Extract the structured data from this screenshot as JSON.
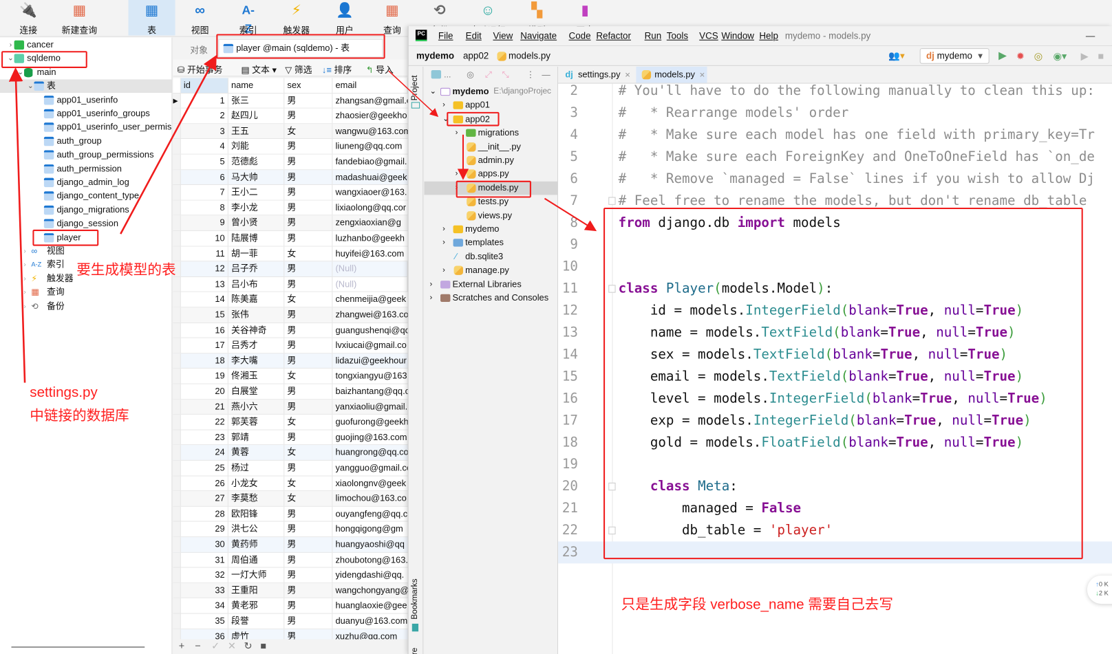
{
  "navicat": {
    "toolbar": [
      {
        "label": "连接",
        "icon": "plug-icon"
      },
      {
        "label": "新建查询",
        "icon": "new-query-icon"
      },
      {
        "label": "表",
        "icon": "table-icon",
        "selected": true
      },
      {
        "label": "视图",
        "icon": "view-icon"
      },
      {
        "label": "索引",
        "icon": "index-icon"
      },
      {
        "label": "触发器",
        "icon": "trigger-icon"
      },
      {
        "label": "用户",
        "icon": "user-icon"
      },
      {
        "label": "查询",
        "icon": "query-icon"
      },
      {
        "label": "备份",
        "icon": "backup-icon"
      },
      {
        "label": "自动运行",
        "icon": "robot-icon"
      },
      {
        "label": "模型",
        "icon": "model-icon"
      },
      {
        "label": "图表",
        "icon": "chart-icon"
      }
    ],
    "tree": {
      "connections": [
        "cancer",
        "sqldemo"
      ],
      "schema": "main",
      "tables_label": "表",
      "tables": [
        "app01_userinfo",
        "app01_userinfo_groups",
        "app01_userinfo_user_permiss",
        "auth_group",
        "auth_group_permissions",
        "auth_permission",
        "django_admin_log",
        "django_content_type",
        "django_migrations",
        "django_session",
        "player"
      ],
      "others": [
        "视图",
        "索引",
        "触发器",
        "查询",
        "备份"
      ]
    },
    "tabs": {
      "objects": "对象",
      "active": "player @main (sqldemo) - 表"
    },
    "table_tools": {
      "begin_tx": "开始事务",
      "text": "文本",
      "filter": "筛选",
      "sort": "排序",
      "import": "导入"
    },
    "grid": {
      "columns": [
        "id",
        "name",
        "sex",
        "email"
      ],
      "null_label": "(Null)",
      "rows": [
        [
          "1",
          "张三",
          "男",
          "zhangsan@gmail.co"
        ],
        [
          "2",
          "赵四儿",
          "男",
          "zhaosier@geekho"
        ],
        [
          "3",
          "王五",
          "女",
          "wangwu@163.com"
        ],
        [
          "4",
          "刘能",
          "男",
          "liuneng@qq.com"
        ],
        [
          "5",
          "范德彪",
          "男",
          "fandebiao@gmail."
        ],
        [
          "6",
          "马大帅",
          "男",
          "madashuai@geek"
        ],
        [
          "7",
          "王小二",
          "男",
          "wangxiaoer@163."
        ],
        [
          "8",
          "李小龙",
          "男",
          "lixiaolong@qq.cor"
        ],
        [
          "9",
          "曾小贤",
          "男",
          "zengxiaoxian@g"
        ],
        [
          "10",
          "陆展博",
          "男",
          "luzhanbo@geekh"
        ],
        [
          "11",
          "胡一菲",
          "女",
          "huyifei@163.com"
        ],
        [
          "12",
          "吕子乔",
          "男",
          null
        ],
        [
          "13",
          "吕小布",
          "男",
          null
        ],
        [
          "14",
          "陈美嘉",
          "女",
          "chenmeijia@geek"
        ],
        [
          "15",
          "张伟",
          "男",
          "zhangwei@163.co"
        ],
        [
          "16",
          "关谷神奇",
          "男",
          "guangushenqi@qc"
        ],
        [
          "17",
          "吕秀才",
          "男",
          "lvxiucai@gmail.co"
        ],
        [
          "18",
          "李大嘴",
          "男",
          "lidazui@geekhour"
        ],
        [
          "19",
          "佟湘玉",
          "女",
          "tongxiangyu@163."
        ],
        [
          "20",
          "白展堂",
          "男",
          "baizhantang@qq.c"
        ],
        [
          "21",
          "燕小六",
          "男",
          "yanxiaoliu@gmail."
        ],
        [
          "22",
          "郭芙蓉",
          "女",
          "guofurong@geekh"
        ],
        [
          "23",
          "郭靖",
          "男",
          "guojing@163.com"
        ],
        [
          "24",
          "黄蓉",
          "女",
          "huangrong@qq.co"
        ],
        [
          "25",
          "杨过",
          "男",
          "yangguo@gmail.co"
        ],
        [
          "26",
          "小龙女",
          "女",
          "xiaolongnv@geek"
        ],
        [
          "27",
          "李莫愁",
          "女",
          "limochou@163.co"
        ],
        [
          "28",
          "欧阳锋",
          "男",
          "ouyangfeng@qq.c"
        ],
        [
          "29",
          "洪七公",
          "男",
          "hongqigong@gm"
        ],
        [
          "30",
          "黄药师",
          "男",
          "huangyaoshi@qq"
        ],
        [
          "31",
          "周伯通",
          "男",
          "zhoubotong@163."
        ],
        [
          "32",
          "一灯大师",
          "男",
          "yidengdashi@qq."
        ],
        [
          "33",
          "王重阳",
          "男",
          "wangchongyang@"
        ],
        [
          "34",
          "黄老邪",
          "男",
          "huanglaoxie@gee"
        ],
        [
          "35",
          "段誉",
          "男",
          "duanyu@163.com"
        ],
        [
          "36",
          "虚竹",
          "男",
          "xuzhu@qq.com"
        ]
      ]
    },
    "grid_footer": [
      "+",
      "−",
      "✓",
      "✕",
      "↻",
      "■"
    ]
  },
  "pycharm": {
    "logo": "PC",
    "menu": [
      "File",
      "Edit",
      "View",
      "Navigate",
      "Code",
      "Refactor",
      "Run",
      "Tools",
      "VCS",
      "Window",
      "Help"
    ],
    "window_title": "mydemo - models.py",
    "breadcrumb": [
      "mydemo",
      "app02",
      "models.py"
    ],
    "run_config": "mydemo",
    "side_tabs": {
      "project": "Project",
      "bookmarks": "Bookmarks",
      "structure": "re"
    },
    "project_tree": [
      {
        "label": "mydemo",
        "hint": "E:\\djangoProjec",
        "depth": 0,
        "open": true,
        "icon": "module"
      },
      {
        "label": "app01",
        "depth": 1,
        "arrow": ">",
        "icon": "folder"
      },
      {
        "label": "app02",
        "depth": 1,
        "open": true,
        "icon": "folder"
      },
      {
        "label": "migrations",
        "depth": 2,
        "arrow": ">",
        "icon": "db-folder"
      },
      {
        "label": "__init__.py",
        "depth": 2,
        "icon": "py"
      },
      {
        "label": "admin.py",
        "depth": 2,
        "icon": "py"
      },
      {
        "label": "apps.py",
        "depth": 2,
        "arrow": ">",
        "icon": "py"
      },
      {
        "label": "models.py",
        "depth": 2,
        "arrow": ">",
        "icon": "py",
        "selected": true
      },
      {
        "label": "tests.py",
        "depth": 2,
        "icon": "py"
      },
      {
        "label": "views.py",
        "depth": 2,
        "icon": "py"
      },
      {
        "label": "mydemo",
        "depth": 1,
        "arrow": ">",
        "icon": "folder"
      },
      {
        "label": "templates",
        "depth": 1,
        "arrow": ">",
        "icon": "tpl-folder"
      },
      {
        "label": "db.sqlite3",
        "depth": 1,
        "icon": "sqlite"
      },
      {
        "label": "manage.py",
        "depth": 1,
        "arrow": ">",
        "icon": "py"
      },
      {
        "label": "External Libraries",
        "depth": 0,
        "arrow": ">",
        "icon": "lib"
      },
      {
        "label": "Scratches and Consoles",
        "depth": 0,
        "arrow": ">",
        "icon": "scratch"
      }
    ],
    "editor_tabs": [
      {
        "label": "settings.py",
        "icon": "dj",
        "active": false
      },
      {
        "label": "models.py",
        "icon": "py",
        "active": true
      }
    ],
    "code": [
      {
        "n": "2",
        "t": [
          [
            "# You'll have to do the following manually to clean this up:",
            "cm"
          ]
        ]
      },
      {
        "n": "3",
        "t": [
          [
            "#   * Rearrange models' order",
            "cm"
          ]
        ]
      },
      {
        "n": "4",
        "t": [
          [
            "#   * Make sure each model has one field with primary_key=Tr",
            "cm"
          ]
        ]
      },
      {
        "n": "5",
        "t": [
          [
            "#   * Make sure each ForeignKey and OneToOneField has `on_de",
            "cm"
          ]
        ]
      },
      {
        "n": "6",
        "t": [
          [
            "#   * Remove `managed = False` lines if you wish to allow Dj",
            "cm"
          ]
        ]
      },
      {
        "n": "7",
        "t": [
          [
            "# Feel free to rename the models, but don't rename db_table",
            "cm"
          ]
        ]
      },
      {
        "n": "8",
        "t": [
          [
            "from",
            "kb"
          ],
          [
            " django.db ",
            ""
          ],
          [
            "import",
            "kb"
          ],
          [
            " models",
            ""
          ]
        ]
      },
      {
        "n": "9",
        "t": []
      },
      {
        "n": "10",
        "t": []
      },
      {
        "n": "11",
        "t": [
          [
            "class",
            "kb"
          ],
          [
            " ",
            ""
          ],
          [
            "Player",
            "cls"
          ],
          [
            "(",
            "p1"
          ],
          [
            "models.Model",
            ""
          ],
          [
            ")",
            "p1"
          ],
          [
            ":",
            ""
          ]
        ]
      },
      {
        "n": "12",
        "t": [
          [
            "    id = models.",
            ""
          ],
          [
            "IntegerField",
            "fn"
          ],
          [
            "(",
            "p1"
          ],
          [
            "blank",
            "kw"
          ],
          [
            "=",
            ""
          ],
          [
            "True",
            "kb"
          ],
          [
            ", ",
            ""
          ],
          [
            "null",
            "kw"
          ],
          [
            "=",
            ""
          ],
          [
            "True",
            "kb"
          ],
          [
            ")",
            "p1"
          ]
        ]
      },
      {
        "n": "13",
        "t": [
          [
            "    name = models.",
            ""
          ],
          [
            "TextField",
            "fn"
          ],
          [
            "(",
            "p1"
          ],
          [
            "blank",
            "kw"
          ],
          [
            "=",
            ""
          ],
          [
            "True",
            "kb"
          ],
          [
            ", ",
            ""
          ],
          [
            "null",
            "kw"
          ],
          [
            "=",
            ""
          ],
          [
            "True",
            "kb"
          ],
          [
            ")",
            "p1"
          ]
        ]
      },
      {
        "n": "14",
        "t": [
          [
            "    sex = models.",
            ""
          ],
          [
            "TextField",
            "fn"
          ],
          [
            "(",
            "p1"
          ],
          [
            "blank",
            "kw"
          ],
          [
            "=",
            ""
          ],
          [
            "True",
            "kb"
          ],
          [
            ", ",
            ""
          ],
          [
            "null",
            "kw"
          ],
          [
            "=",
            ""
          ],
          [
            "True",
            "kb"
          ],
          [
            ")",
            "p1"
          ]
        ]
      },
      {
        "n": "15",
        "t": [
          [
            "    email = models.",
            ""
          ],
          [
            "TextField",
            "fn"
          ],
          [
            "(",
            "p1"
          ],
          [
            "blank",
            "kw"
          ],
          [
            "=",
            ""
          ],
          [
            "True",
            "kb"
          ],
          [
            ", ",
            ""
          ],
          [
            "null",
            "kw"
          ],
          [
            "=",
            ""
          ],
          [
            "True",
            "kb"
          ],
          [
            ")",
            "p1"
          ]
        ]
      },
      {
        "n": "16",
        "t": [
          [
            "    level = models.",
            ""
          ],
          [
            "IntegerField",
            "fn"
          ],
          [
            "(",
            "p1"
          ],
          [
            "blank",
            "kw"
          ],
          [
            "=",
            ""
          ],
          [
            "True",
            "kb"
          ],
          [
            ", ",
            ""
          ],
          [
            "null",
            "kw"
          ],
          [
            "=",
            ""
          ],
          [
            "True",
            "kb"
          ],
          [
            ")",
            "p1"
          ]
        ]
      },
      {
        "n": "17",
        "t": [
          [
            "    exp = models.",
            ""
          ],
          [
            "IntegerField",
            "fn"
          ],
          [
            "(",
            "p1"
          ],
          [
            "blank",
            "kw"
          ],
          [
            "=",
            ""
          ],
          [
            "True",
            "kb"
          ],
          [
            ", ",
            ""
          ],
          [
            "null",
            "kw"
          ],
          [
            "=",
            ""
          ],
          [
            "True",
            "kb"
          ],
          [
            ")",
            "p1"
          ]
        ]
      },
      {
        "n": "18",
        "t": [
          [
            "    gold = models.",
            ""
          ],
          [
            "FloatField",
            "fn"
          ],
          [
            "(",
            "p1"
          ],
          [
            "blank",
            "kw"
          ],
          [
            "=",
            ""
          ],
          [
            "True",
            "kb"
          ],
          [
            ", ",
            ""
          ],
          [
            "null",
            "kw"
          ],
          [
            "=",
            ""
          ],
          [
            "True",
            "kb"
          ],
          [
            ")",
            "p1"
          ]
        ]
      },
      {
        "n": "19",
        "t": []
      },
      {
        "n": "20",
        "t": [
          [
            "    ",
            ""
          ],
          [
            "class",
            "kb"
          ],
          [
            " ",
            ""
          ],
          [
            "Meta",
            "cls"
          ],
          [
            ":",
            ""
          ]
        ]
      },
      {
        "n": "21",
        "t": [
          [
            "        managed = ",
            ""
          ],
          [
            "False",
            "kb"
          ]
        ]
      },
      {
        "n": "22",
        "t": [
          [
            "        db_table = ",
            ""
          ],
          [
            "'player'",
            "str"
          ]
        ]
      },
      {
        "n": "23",
        "t": [],
        "current": true
      }
    ],
    "net_widget": {
      "up": "0 K",
      "down": "2 K"
    }
  },
  "annotations": {
    "table_note": "要生成模型的表",
    "settings_note_1": "settings.py",
    "settings_note_2": "中链接的数据库",
    "code_note": "只是生成字段 verbose_name 需要自己去写"
  },
  "colors": {
    "annotation": "#ff1f1f",
    "toolbar_selected": "#d8e8f7",
    "current_line": "#e8f0fb",
    "keyword": "#871094"
  }
}
